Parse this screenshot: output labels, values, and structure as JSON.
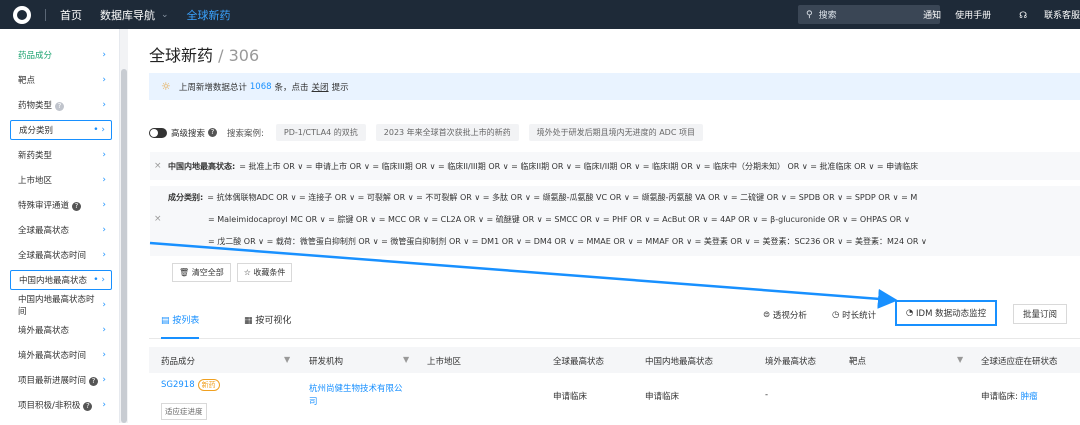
{
  "topbar": {
    "home": "首页",
    "db_nav": "数据库导航",
    "global_new_drugs": "全球新药",
    "search_placeholder": "搜索",
    "notice": "通知",
    "manual": "使用手册",
    "contact": "联系客服"
  },
  "sidebar": {
    "items": [
      {
        "label": "药品成分"
      },
      {
        "label": "靶点"
      },
      {
        "label": "药物类型"
      },
      {
        "label": "成分类别"
      },
      {
        "label": "新药类型"
      },
      {
        "label": "上市地区"
      },
      {
        "label": "特殊审评通道"
      },
      {
        "label": "全球最高状态"
      },
      {
        "label": "全球最高状态时间"
      },
      {
        "label": "中国内地最高状态"
      },
      {
        "label": "中国内地最高状态时间"
      },
      {
        "label": "境外最高状态"
      },
      {
        "label": "境外最高状态时间"
      },
      {
        "label": "项目最新进展时间"
      },
      {
        "label": "项目积极/非积极"
      }
    ]
  },
  "page": {
    "title": "全球新药",
    "count": "/ 306"
  },
  "notice": {
    "prefix": "上周新增数据总计",
    "num": "1068",
    "mid": "条，点击",
    "link": "关闭",
    "suffix": "提示"
  },
  "advanced": {
    "label": "高级搜索",
    "example_label": "搜索案例:",
    "tags": [
      "PD-1/CTLA4 的双抗",
      "2023 年来全球首次获批上市的新药",
      "境外处于研发后期且境内无进度的 ADC 项目"
    ]
  },
  "filter1": {
    "label": "中国内地最高状态:",
    "line": "= 批准上市   OR ∨   = 申请上市   OR ∨   = 临床III期   OR ∨   = 临床II/III期   OR ∨   = 临床II期   OR ∨   = 临床I/II期   OR ∨   = 临床I期   OR ∨   = 临床中（分期未知）   OR ∨   = 批准临床   OR ∨   = 申请临床"
  },
  "filter2": {
    "label": "成分类别:",
    "line1": "= 抗体偶联物ADC   OR ∨   = 连接子   OR ∨   = 可裂解   OR ∨   = 不可裂解   OR ∨   = 多肽   OR ∨   = 缬氨酸-瓜氨酸 VC   OR ∨   = 缬氨酸-丙氨酸 VA   OR ∨   = 二硫键   OR ∨   = SPDB   OR ∨   = SPDP   OR ∨   = M",
    "line2": "= Maleimidocaproyl MC   OR ∨   = 腙键   OR ∨   = MCC   OR ∨   = CL2A   OR ∨   = 硫醚键   OR ∨   = SMCC   OR ∨   = PHF   OR ∨   = AcBut   OR ∨   = 4AP   OR ∨   = β-glucuronide   OR ∨   = OHPAS   OR ∨",
    "line3": "= 戊二酸   OR ∨   = 载荷：微管蛋白抑制剂   OR ∨   = 微管蛋白抑制剂   OR ∨   = DM1   OR ∨   = DM4   OR ∨   = MMAE   OR ∨   = MMAF   OR ∨   = 美登素   OR ∨   = 美登素：SC236   OR ∨   = 美登素：M24   OR ∨"
  },
  "buttons": {
    "clear_all": "清空全部",
    "save": "收藏条件"
  },
  "tabs": {
    "list": "按列表",
    "visual": "按可视化",
    "pivot": "透视分析",
    "duration": "时长统计",
    "idm": "IDM 数据动态监控",
    "batch": "批量订阅"
  },
  "table": {
    "headers": [
      "药品成分",
      "研发机构",
      "上市地区",
      "全球最高状态",
      "中国内地最高状态",
      "境外最高状态",
      "靶点",
      "全球适应症在研状态"
    ],
    "row": {
      "drug": "SG2918",
      "new_badge": "新药",
      "progress_btn": "适应症进度",
      "org": "杭州尚健生物技术有限公司",
      "global_status": "申请临床",
      "cn_status": "申请临床",
      "overseas_status": "-",
      "indication_label": "申请临床:",
      "indication": "肿瘤"
    }
  },
  "colors": {
    "accent": "#1890ff",
    "topbar": "#1e2a38",
    "green": "#1aa36f"
  }
}
